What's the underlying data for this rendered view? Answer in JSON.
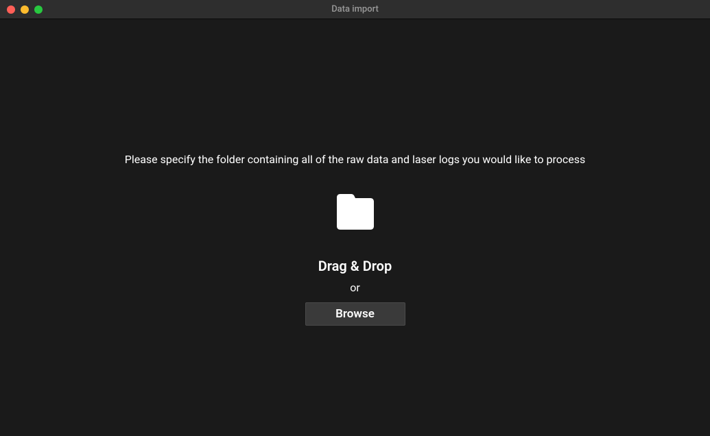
{
  "window": {
    "title": "Data import"
  },
  "main": {
    "instruction": "Please specify the folder containing all of the raw data and laser logs you would like to process",
    "dragDropLabel": "Drag & Drop",
    "orLabel": "or",
    "browseButtonLabel": "Browse"
  }
}
